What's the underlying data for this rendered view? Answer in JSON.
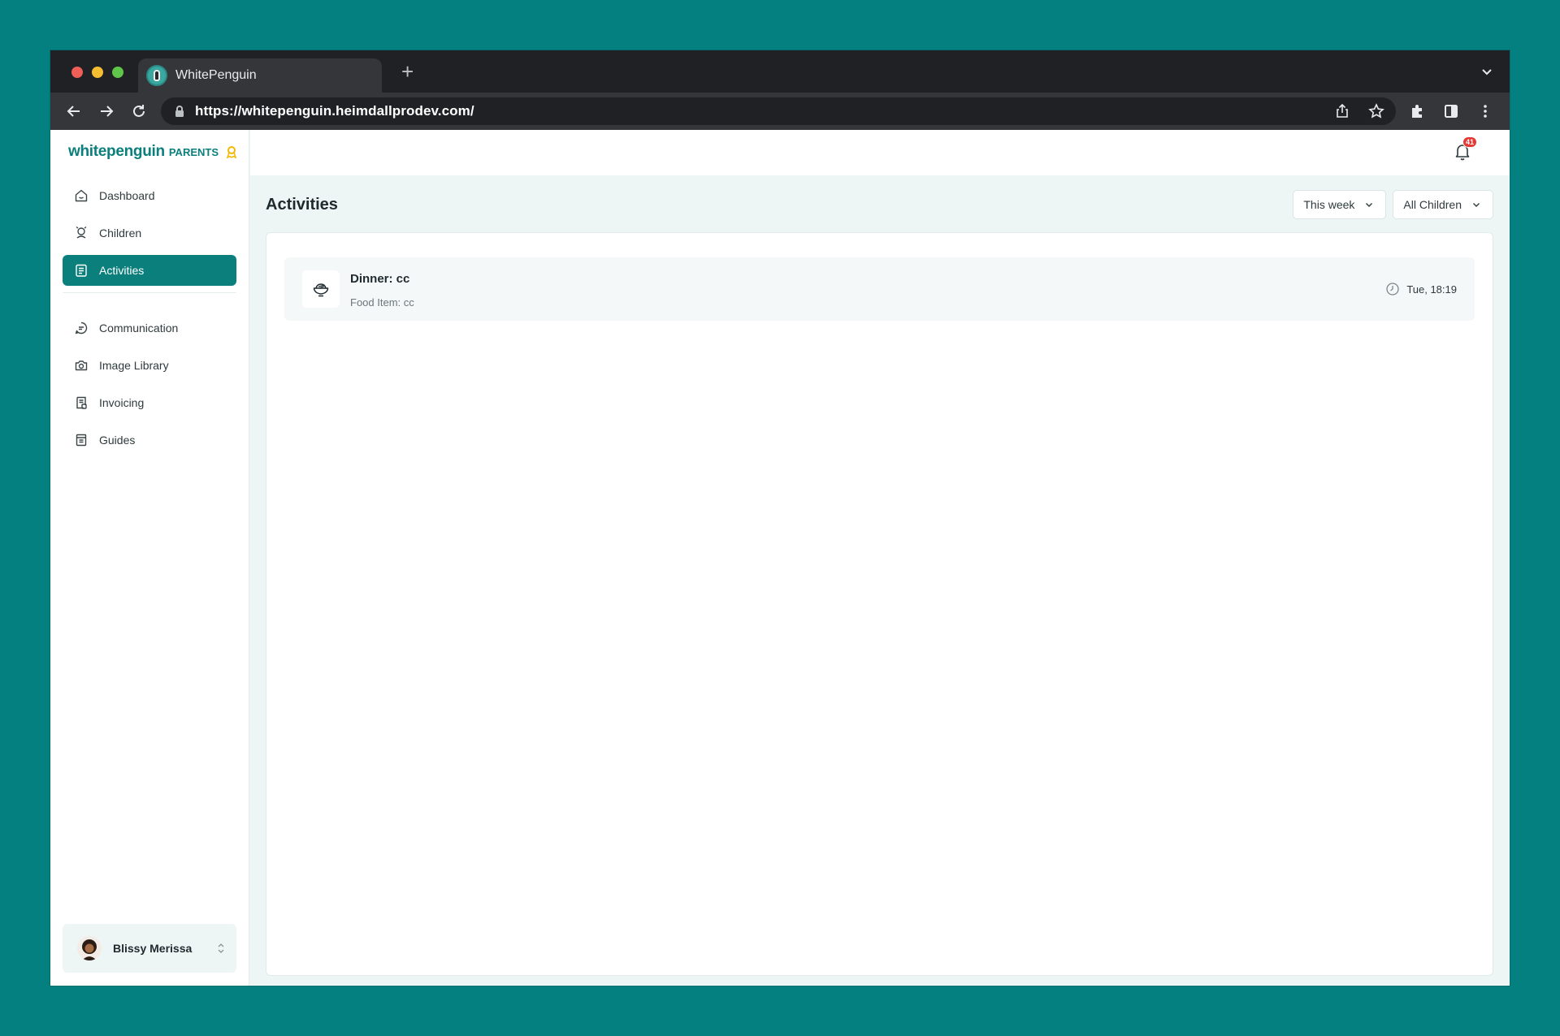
{
  "browser": {
    "tab_title": "WhitePenguin",
    "new_tab_symbol": "+",
    "url": "https://whitepenguin.heimdallprodev.com/"
  },
  "brand": {
    "name": "whitepenguin",
    "suffix": "PARENTS"
  },
  "sidebar": {
    "items": [
      {
        "label": "Dashboard",
        "icon": "home-icon"
      },
      {
        "label": "Children",
        "icon": "children-icon"
      },
      {
        "label": "Activities",
        "icon": "clipboard-icon",
        "active": true
      },
      {
        "label": "Communication",
        "icon": "chat-icon"
      },
      {
        "label": "Image Library",
        "icon": "camera-icon"
      },
      {
        "label": "Invoicing",
        "icon": "invoice-icon"
      },
      {
        "label": "Guides",
        "icon": "book-icon"
      }
    ],
    "user": {
      "name": "Blissy Merissa"
    }
  },
  "header": {
    "notification_count": "41"
  },
  "main": {
    "title": "Activities",
    "filters": {
      "period": "This week",
      "children": "All Children"
    },
    "activities": [
      {
        "title": "Dinner: cc",
        "subtitle": "Food Item: cc",
        "time": "Tue, 18:19",
        "icon": "bowl-icon"
      }
    ]
  },
  "colors": {
    "accent": "#0b7f7c",
    "background": "#058080",
    "badge": "#e53935"
  }
}
